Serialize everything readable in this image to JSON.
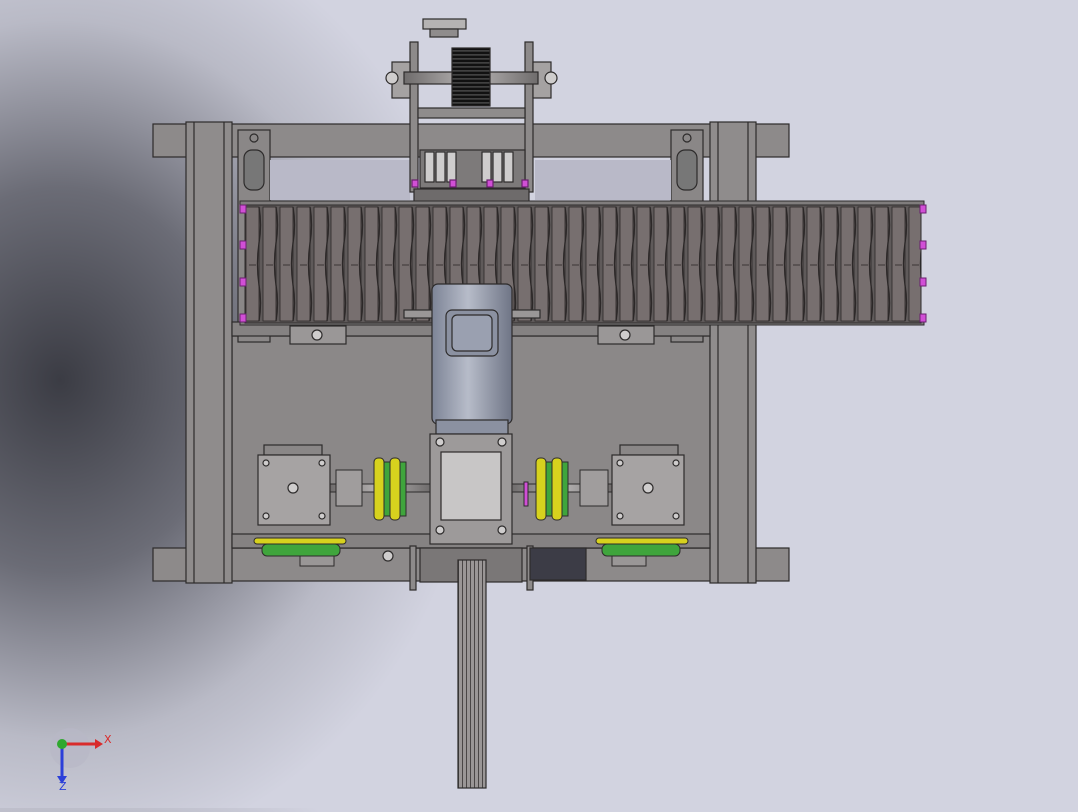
{
  "viewport": {
    "background_center": "#3b3c44",
    "background_edge": "#d2d3e0",
    "metal_color": "#8d8a8a",
    "dark_metal": "#6e6b6b",
    "motor_color": "#9ea4b4",
    "pulley_yellow": "#d7d21e",
    "pulley_green": "#3fa53c",
    "fastener_magenta": "#d14fd6"
  },
  "triad": {
    "x_label": "X",
    "z_label": "Z",
    "x_color": "#d92b2b",
    "y_color": "#2fa82f",
    "z_color": "#2b3fd9"
  }
}
